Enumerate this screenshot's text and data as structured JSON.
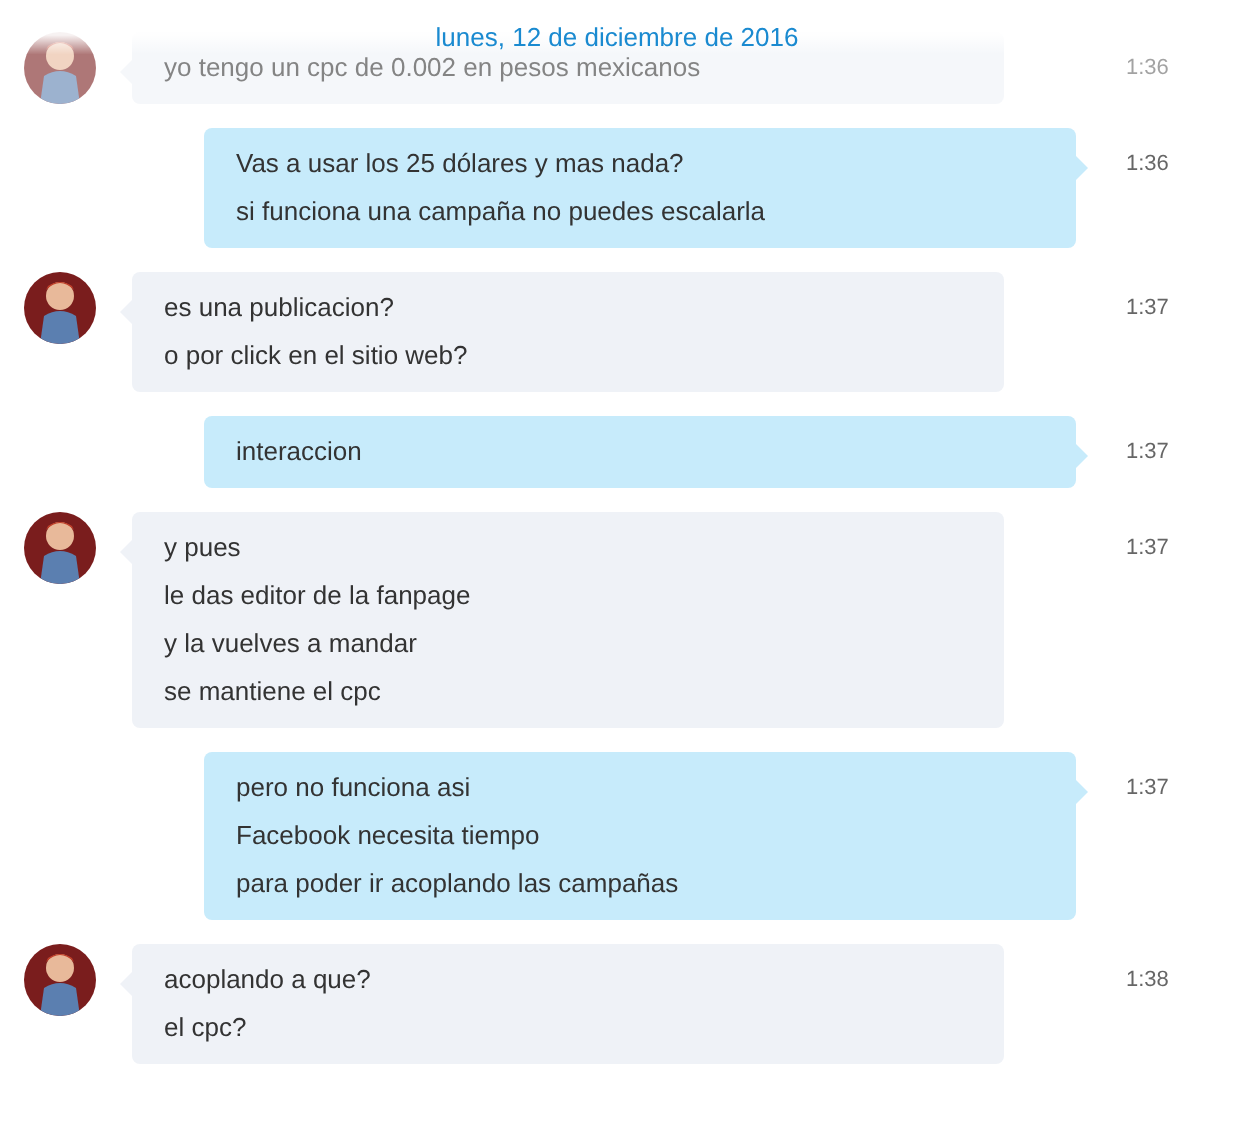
{
  "date_header": "lunes, 12 de diciembre de 2016",
  "messages": [
    {
      "kind": "incoming",
      "faded": true,
      "lines": [
        "yo tengo un cpc de 0.002 en pesos mexicanos"
      ],
      "time": "1:36"
    },
    {
      "kind": "outgoing",
      "faded": false,
      "lines": [
        "Vas a usar los 25 dólares y mas nada?",
        "si funciona una campaña no puedes escalarla"
      ],
      "time": "1:36"
    },
    {
      "kind": "incoming",
      "faded": false,
      "lines": [
        "es una publicacion?",
        "o por click en el sitio web?"
      ],
      "time": "1:37"
    },
    {
      "kind": "outgoing",
      "faded": false,
      "lines": [
        "interaccion"
      ],
      "time": "1:37"
    },
    {
      "kind": "incoming",
      "faded": false,
      "lines": [
        "y pues",
        "le das editor de la fanpage",
        "y la vuelves a mandar",
        "se mantiene el cpc"
      ],
      "time": "1:37"
    },
    {
      "kind": "outgoing",
      "faded": false,
      "lines": [
        "pero no funciona asi",
        "Facebook necesita tiempo",
        "para poder ir acoplando las campañas"
      ],
      "time": "1:37"
    },
    {
      "kind": "incoming",
      "faded": false,
      "lines": [
        "acoplando a que?",
        "el cpc?"
      ],
      "time": "1:38"
    }
  ]
}
